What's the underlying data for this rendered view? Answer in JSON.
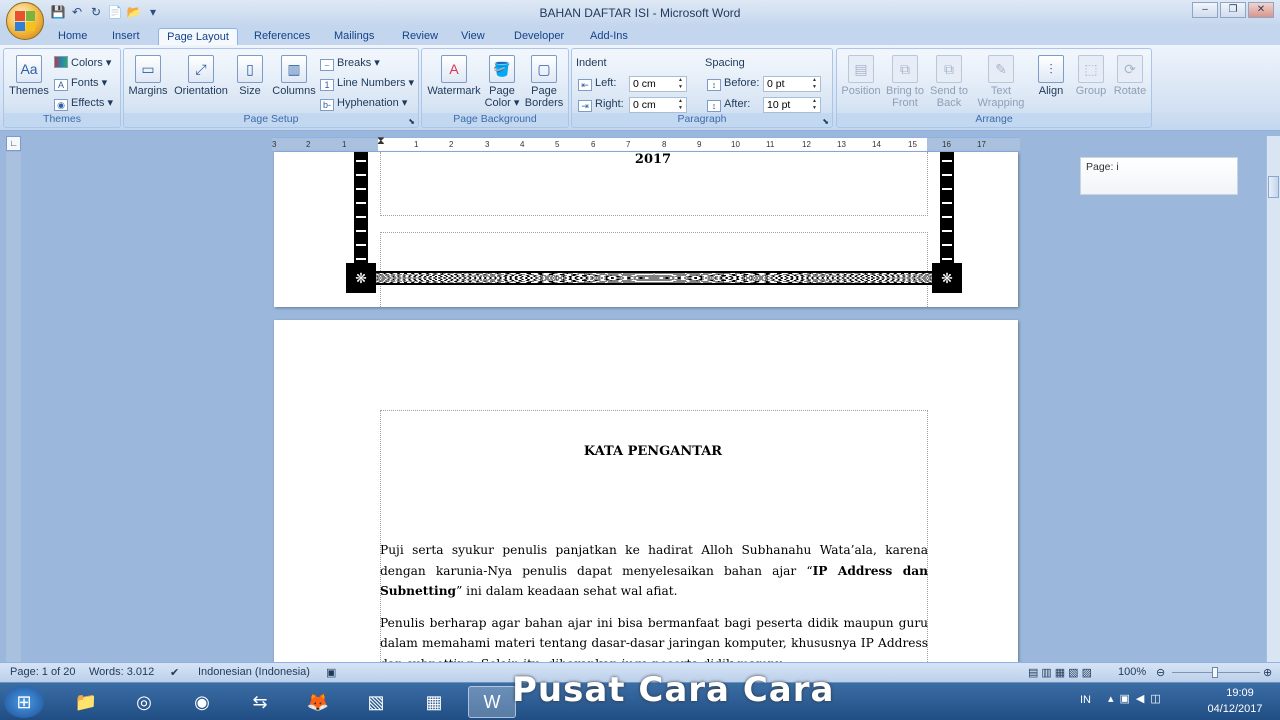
{
  "window": {
    "title": "BAHAN DAFTAR ISI - Microsoft Word"
  },
  "tabs": [
    "Home",
    "Insert",
    "Page Layout",
    "References",
    "Mailings",
    "Review",
    "View",
    "Developer",
    "Add-Ins"
  ],
  "active_tab": "Page Layout",
  "ribbon": {
    "themes": {
      "themes_label": "Themes",
      "colors": "Colors",
      "fonts": "Fonts",
      "effects": "Effects",
      "group_label": "Themes"
    },
    "page_setup": {
      "margins": "Margins",
      "orientation": "Orientation",
      "size": "Size",
      "columns": "Columns",
      "breaks": "Breaks",
      "line_numbers": "Line Numbers",
      "hyphenation": "Hyphenation",
      "group_label": "Page Setup"
    },
    "page_background": {
      "watermark": "Watermark",
      "page_color_1": "Page",
      "page_color_2": "Color",
      "page_borders_1": "Page",
      "page_borders_2": "Borders",
      "group_label": "Page Background"
    },
    "paragraph": {
      "indent_label": "Indent",
      "left_label": "Left:",
      "left_value": "0 cm",
      "right_label": "Right:",
      "right_value": "0 cm",
      "spacing_label": "Spacing",
      "before_label": "Before:",
      "before_value": "0 pt",
      "after_label": "After:",
      "after_value": "10 pt",
      "group_label": "Paragraph"
    },
    "arrange": {
      "position": "Position",
      "bring_front_1": "Bring to",
      "bring_front_2": "Front",
      "send_back_1": "Send to",
      "send_back_2": "Back",
      "text_wrap_1": "Text",
      "text_wrap_2": "Wrapping",
      "align": "Align",
      "group": "Group",
      "rotate": "Rotate",
      "group_label": "Arrange"
    }
  },
  "ruler": {
    "ticks": [
      "3",
      "2",
      "1",
      "1",
      "2",
      "3",
      "4",
      "5",
      "6",
      "7",
      "8",
      "9",
      "10",
      "11",
      "12",
      "13",
      "14",
      "15",
      "16",
      "17"
    ]
  },
  "document": {
    "page1_year": "2017",
    "heading": "KATA PENGANTAR",
    "para1_a": "Puji serta syukur penulis panjatkan ke hadirat Alloh Subhanahu Wata’ala, karena dengan karunia-Nya penulis dapat menyelesaikan bahan ajar “",
    "para1_bold": "IP Address dan Subnetting",
    "para1_b": "” ini dalam keadaan sehat wal afiat.",
    "para2": "Penulis berharap agar bahan ajar ini bisa bermanfaat bagi peserta didik maupun guru dalam memahami materi tentang dasar-dasar jaringan komputer, khususnya IP Address dan subnetting. Selain itu, diharapkan juga peserta didik mampu"
  },
  "comment": {
    "text": "Page: i"
  },
  "status": {
    "page": "Page: 1 of 20",
    "words": "Words: 3.012",
    "language": "Indonesian (Indonesia)",
    "zoom": "100%"
  },
  "taskbar": {
    "lang": "IN",
    "time": "19:09",
    "date": "04/12/2017"
  },
  "watermark": "Pusat Cara Cara"
}
